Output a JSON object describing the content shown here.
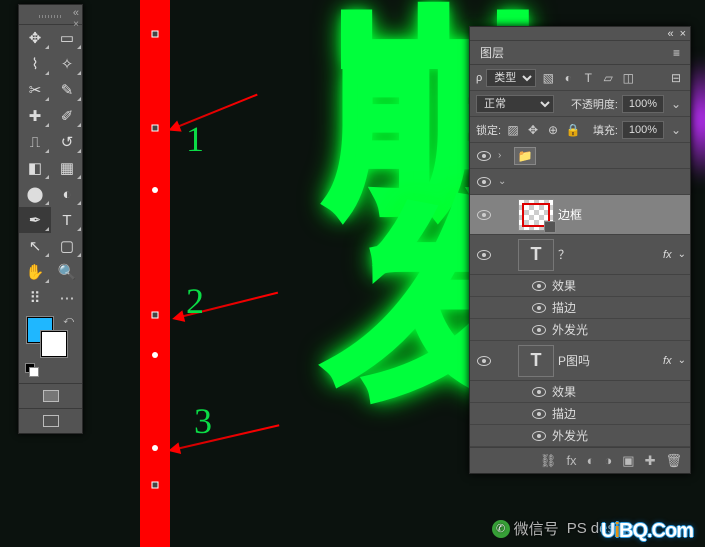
{
  "annotations": {
    "n1": "1",
    "n2": "2",
    "n3": "3"
  },
  "toolbar": {
    "tools": [
      "move",
      "artboard",
      "lasso",
      "magic-wand",
      "crop",
      "eyedropper",
      "healing",
      "brush",
      "stamp",
      "history-brush",
      "eraser",
      "gradient",
      "blur",
      "dodge",
      "pen",
      "type",
      "path-select",
      "rectangle",
      "hand",
      "zoom",
      "edit-toolbar",
      "ellipsis"
    ],
    "fg_color": "#1fb7ff",
    "bg_color": "#ffffff"
  },
  "layers_panel": {
    "title": "图层",
    "type_filter": "类型",
    "blend_mode": "正常",
    "opacity_label": "不透明度:",
    "opacity_value": "100%",
    "lock_label": "锁定:",
    "fill_label": "填充:",
    "fill_value": "100%",
    "layers": [
      {
        "kind": "folder",
        "name": ""
      },
      {
        "kind": "group-open",
        "name": ""
      },
      {
        "kind": "shape",
        "name": "边框",
        "selected": true
      },
      {
        "kind": "text",
        "name": "？",
        "fx": true,
        "effects_label": "效果",
        "effects": [
          "描边",
          "外发光"
        ]
      },
      {
        "kind": "text",
        "name": "P图吗",
        "fx": true,
        "effects_label": "效果",
        "effects": [
          "描边",
          "外发光"
        ]
      }
    ]
  },
  "watermark": {
    "wechat": "微信号",
    "brand": "design",
    "site": "UiBQ.Com"
  }
}
